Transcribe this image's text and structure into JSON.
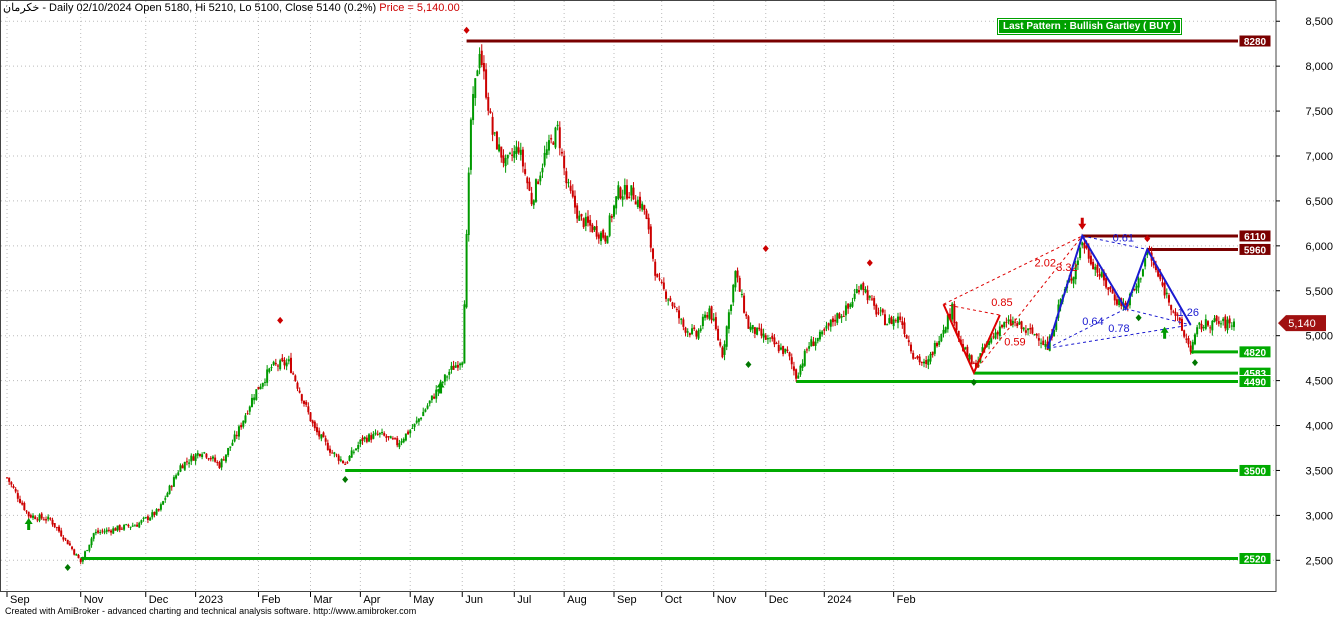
{
  "header": {
    "symbol": "خکرمان",
    "text": " - Daily 02/10/2024 Open 5180, Hi 5210, Lo 5100, Close 5140 (0.2%) ",
    "price_text": "Price = 5,140.00"
  },
  "footer": {
    "text": "Created with AmiBroker - advanced charting and technical analysis software. http://www.amibroker.com"
  },
  "pattern_label": "Last Pattern : Bullish Gartley ( BUY )",
  "colors": {
    "up": "#009900",
    "down": "#cc0000",
    "support": "#00aa00",
    "resistance": "#7a0000",
    "pattern_red": "#dd0000",
    "pattern_blue": "#1a1ad0",
    "grid": "#bbbbbb"
  },
  "chart_data": {
    "type": "candlestick",
    "ylim": [
      2200,
      8700
    ],
    "y_ticks": [
      "2,500",
      "3,000",
      "3,500",
      "4,000",
      "4,500",
      "5,000",
      "5,500",
      "6,000",
      "6,500",
      "7,000",
      "7,500",
      "8,000",
      "8,500"
    ],
    "y_tick_values": [
      2500,
      3000,
      3500,
      4000,
      4500,
      5000,
      5500,
      6000,
      6500,
      7000,
      7500,
      8000,
      8500
    ],
    "x_month_labels": [
      "Sep",
      "Nov",
      "Dec",
      "2023",
      "Feb",
      "Mar",
      "Apr",
      "May",
      "Jun",
      "Jul",
      "Aug",
      "Sep",
      "Oct",
      "Nov",
      "Dec",
      "2024",
      "Feb"
    ],
    "last_price_label": "5,140",
    "last_price": 5140,
    "anchor_closes": [
      [
        0,
        3420
      ],
      [
        10,
        3000
      ],
      [
        20,
        2950
      ],
      [
        28,
        2700
      ],
      [
        34,
        2480
      ],
      [
        40,
        2800
      ],
      [
        50,
        2850
      ],
      [
        60,
        2900
      ],
      [
        70,
        3050
      ],
      [
        80,
        3550
      ],
      [
        90,
        3720
      ],
      [
        98,
        3560
      ],
      [
        106,
        3900
      ],
      [
        114,
        4350
      ],
      [
        122,
        4650
      ],
      [
        130,
        4700
      ],
      [
        136,
        4320
      ],
      [
        142,
        3950
      ],
      [
        150,
        3700
      ],
      [
        156,
        3580
      ],
      [
        164,
        3850
      ],
      [
        172,
        3900
      ],
      [
        180,
        3800
      ],
      [
        188,
        4000
      ],
      [
        196,
        4300
      ],
      [
        204,
        4600
      ],
      [
        210,
        4750
      ],
      [
        214,
        7400
      ],
      [
        218,
        8200
      ],
      [
        224,
        7250
      ],
      [
        230,
        6900
      ],
      [
        236,
        7100
      ],
      [
        242,
        6500
      ],
      [
        248,
        7000
      ],
      [
        254,
        7300
      ],
      [
        258,
        6700
      ],
      [
        264,
        6300
      ],
      [
        270,
        6200
      ],
      [
        276,
        6100
      ],
      [
        282,
        6600
      ],
      [
        288,
        6600
      ],
      [
        294,
        6400
      ],
      [
        300,
        5600
      ],
      [
        306,
        5400
      ],
      [
        312,
        5100
      ],
      [
        318,
        5000
      ],
      [
        324,
        5300
      ],
      [
        330,
        4800
      ],
      [
        336,
        5700
      ],
      [
        342,
        5100
      ],
      [
        348,
        5000
      ],
      [
        354,
        4900
      ],
      [
        360,
        4800
      ],
      [
        364,
        4550
      ],
      [
        370,
        4900
      ],
      [
        376,
        5000
      ],
      [
        382,
        5200
      ],
      [
        388,
        5300
      ],
      [
        394,
        5600
      ],
      [
        400,
        5300
      ],
      [
        406,
        5150
      ],
      [
        412,
        5200
      ],
      [
        418,
        4800
      ],
      [
        424,
        4650
      ],
      [
        430,
        5000
      ],
      [
        436,
        5300
      ],
      [
        440,
        4900
      ],
      [
        446,
        4650
      ],
      [
        452,
        4900
      ],
      [
        458,
        5100
      ],
      [
        464,
        5150
      ],
      [
        470,
        5050
      ],
      [
        476,
        5000
      ],
      [
        480,
        4850
      ],
      [
        486,
        5400
      ],
      [
        492,
        5700
      ],
      [
        496,
        6050
      ],
      [
        500,
        5850
      ],
      [
        506,
        5600
      ],
      [
        512,
        5400
      ],
      [
        516,
        5330
      ],
      [
        522,
        5600
      ],
      [
        526,
        5950
      ],
      [
        532,
        5600
      ],
      [
        538,
        5300
      ],
      [
        542,
        5050
      ],
      [
        546,
        4860
      ],
      [
        550,
        5100
      ],
      [
        556,
        5150
      ],
      [
        562,
        5130
      ],
      [
        566,
        5140
      ]
    ],
    "bar_count": 567,
    "levels": [
      {
        "label": "8280",
        "value": 8280,
        "type": "resistance",
        "start_bar": 212
      },
      {
        "label": "6110",
        "value": 6110,
        "type": "resistance",
        "start_bar": 496
      },
      {
        "label": "5960",
        "value": 5960,
        "type": "resistance",
        "start_bar": 526
      },
      {
        "label": "4820",
        "value": 4820,
        "type": "support",
        "start_bar": 546
      },
      {
        "label": "4583",
        "value": 4583,
        "type": "support",
        "start_bar": 446
      },
      {
        "label": "4490",
        "value": 4490,
        "type": "support",
        "start_bar": 364
      },
      {
        "label": "3500",
        "value": 3500,
        "type": "support",
        "start_bar": 156
      },
      {
        "label": "2520",
        "value": 2520,
        "type": "support",
        "start_bar": 34
      }
    ],
    "pattern_red": {
      "points": [
        [
          432,
          5350
        ],
        [
          446,
          4590
        ],
        [
          458,
          5230
        ]
      ],
      "ratio_labels": [
        {
          "text": "0.85",
          "bar": 454,
          "value": 5330
        },
        {
          "text": "0.59",
          "bar": 460,
          "value": 4890
        },
        {
          "text": "2.02",
          "bar": 474,
          "value": 5770
        },
        {
          "text": "3.32",
          "bar": 484,
          "value": 5720
        }
      ]
    },
    "pattern_blue": {
      "points": [
        [
          480,
          4860
        ],
        [
          496,
          6110
        ],
        [
          516,
          5300
        ],
        [
          526,
          5960
        ],
        [
          546,
          5120
        ]
      ],
      "ratio_labels": [
        {
          "text": "0.61",
          "bar": 510,
          "value": 6050
        },
        {
          "text": "0.64",
          "bar": 496,
          "value": 5120
        },
        {
          "text": "0.78",
          "bar": 508,
          "value": 5040
        },
        {
          "text": "1.26",
          "bar": 540,
          "value": 5220
        }
      ]
    },
    "buy_arrows": [
      [
        10,
        2870
      ],
      [
        200,
        4390
      ],
      [
        534,
        5000
      ]
    ],
    "sell_arrows": [
      [
        496,
        6280
      ]
    ],
    "red_diamonds": [
      [
        126,
        5170
      ],
      [
        212,
        8400
      ],
      [
        350,
        5970
      ],
      [
        398,
        5810
      ],
      [
        526,
        6080
      ]
    ],
    "green_diamonds": [
      [
        28,
        2420
      ],
      [
        156,
        3400
      ],
      [
        342,
        4680
      ],
      [
        446,
        4480
      ],
      [
        522,
        5200
      ],
      [
        548,
        4700
      ]
    ]
  }
}
